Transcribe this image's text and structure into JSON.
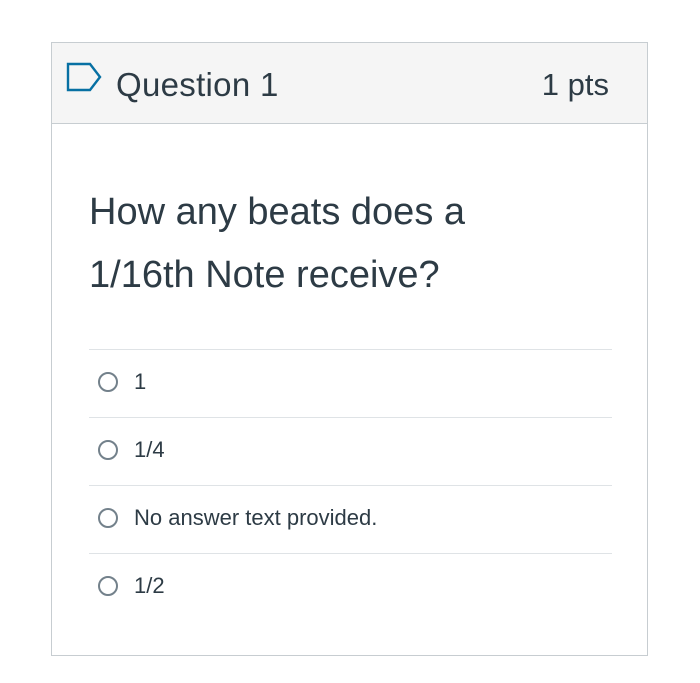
{
  "question": {
    "title": "Question 1",
    "points": "1 pts",
    "flag_icon": "flag-outline-icon",
    "text_line1": "How any beats does a",
    "text_line2": "1/16th Note receive?"
  },
  "answers": [
    {
      "label": "1",
      "selected": false
    },
    {
      "label": "1/4",
      "selected": false
    },
    {
      "label": "No answer text provided.",
      "selected": false
    },
    {
      "label": "1/2",
      "selected": false
    }
  ],
  "colors": {
    "text": "#2d3b45",
    "header_bg": "#f5f5f5",
    "border": "#c7cdd1",
    "flag_accent": "#0770a3"
  }
}
